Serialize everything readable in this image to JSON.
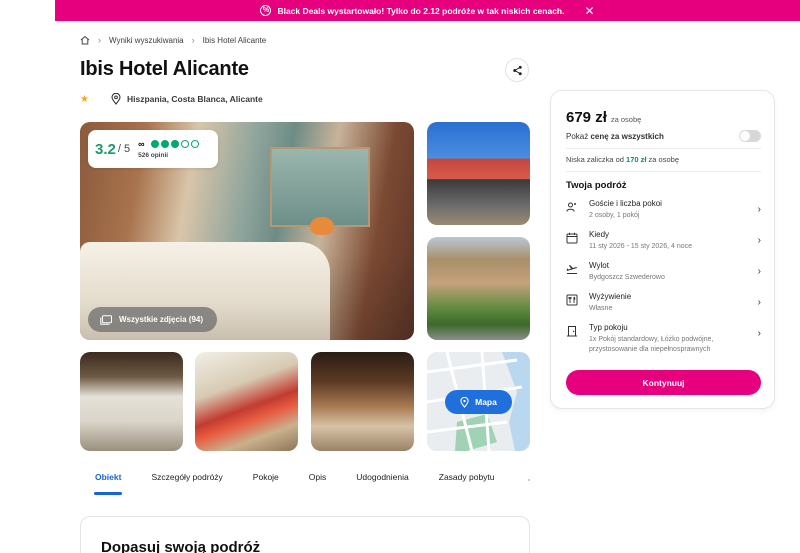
{
  "banner": {
    "text": "Black Deals wystartowało! Tylko do 2.12 podróże w tak niskich cenach."
  },
  "breadcrumb": {
    "items": [
      "Wyniki wyszukiwania",
      "Ibis Hotel Alicante"
    ]
  },
  "hotel": {
    "name": "Ibis Hotel Alicante",
    "stars": 1,
    "location": "Hiszpania, Costa Blanca, Alicante"
  },
  "rating": {
    "score": "3.2",
    "scale": "/ 5",
    "reviews": "526 opinii",
    "dots_filled": 3,
    "dots_total": 5
  },
  "gallery": {
    "all_photos": "Wszystkie zdjęcia (94)",
    "map_label": "Mapa"
  },
  "tabs": [
    "Obiekt",
    "Szczegóły podróży",
    "Pokoje",
    "Opis",
    "Udogodnienia",
    "Zasady pobytu"
  ],
  "section": {
    "heading": "Dopasuj swoją podróż"
  },
  "booking": {
    "price": "679 zł",
    "price_note": "za osobę",
    "toggle_prefix": "Pokaż ",
    "toggle_bold": "cenę za wszystkich",
    "deposit_prefix": "Niska zaliczka od ",
    "deposit_amount": "170 zł",
    "deposit_suffix": " za osobę",
    "trip_heading": "Twoja podróż",
    "rows": [
      {
        "label": "Goście i liczba pokoi",
        "value": "2 osoby, 1 pokój"
      },
      {
        "label": "Kiedy",
        "value": "11 sty 2026 - 15 sty 2026, 4 noce"
      },
      {
        "label": "Wylot",
        "value": "Bydgoszcz Szwederowo"
      },
      {
        "label": "Wyżywienie",
        "value": "Własne"
      },
      {
        "label": "Typ pokoju",
        "value": "1x Pokój standardowy, Łóżko podwójne, przystosowanie dla niepełnosprawnych"
      }
    ],
    "cta": "Kontynuuj"
  },
  "colors": {
    "brand": "#e6007e",
    "accent": "#1565d8",
    "rating": "#00aa6c"
  }
}
